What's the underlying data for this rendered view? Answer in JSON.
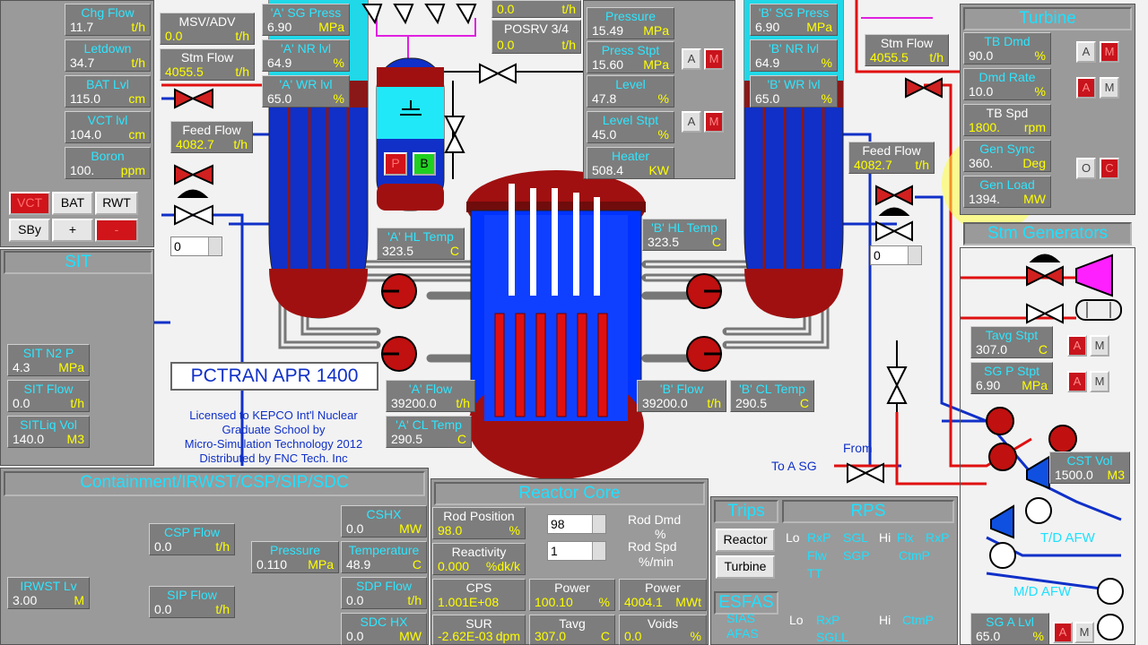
{
  "cvcs": {
    "chg_flow": {
      "label": "Chg Flow",
      "value": "11.7",
      "unit": "t/h"
    },
    "letdown": {
      "label": "Letdown",
      "value": "34.7",
      "unit": "t/h"
    },
    "bat_lvl": {
      "label": "BAT Lvl",
      "value": "115.0",
      "unit": "cm"
    },
    "vct_lvl": {
      "label": "VCT lvl",
      "value": "104.0",
      "unit": "cm"
    },
    "boron": {
      "label": "Boron",
      "value": "100.",
      "unit": "ppm"
    },
    "buttons": {
      "vct": "VCT",
      "bat": "BAT",
      "rwt": "RWT",
      "sby": "SBy",
      "plus": "+",
      "minus": "-"
    }
  },
  "msv": {
    "label": "MSV/ADV",
    "value": "0.0",
    "unit": "t/h"
  },
  "a_stm_flow": {
    "label": "Stm Flow",
    "value": "4055.5",
    "unit": "t/h"
  },
  "a_feed_flow": {
    "label": "Feed Flow",
    "value": "4082.7",
    "unit": "t/h"
  },
  "a_feed_spin": "0",
  "sg_a": {
    "press": {
      "label": "'A' SG Press",
      "value": "6.90",
      "unit": "MPa"
    },
    "nr": {
      "label": "'A' NR lvl",
      "value": "64.9",
      "unit": "%"
    },
    "wr": {
      "label": "'A' WR lvl",
      "value": "65.0",
      "unit": "%"
    }
  },
  "pzr_valves": {
    "top_value": "0.0",
    "top_unit": "t/h",
    "posrv_label": "POSRV 3/4",
    "posrv_value": "0.0",
    "posrv_unit": "t/h"
  },
  "pzr_buttons": {
    "p": "P",
    "b": "B"
  },
  "pressurizer": {
    "pressure": {
      "label": "Pressure",
      "value": "15.49",
      "unit": "MPa"
    },
    "press_stpt": {
      "label": "Press Stpt",
      "value": "15.60",
      "unit": "MPa"
    },
    "level": {
      "label": "Level",
      "value": "47.8",
      "unit": "%"
    },
    "level_stpt": {
      "label": "Level Stpt",
      "value": "45.0",
      "unit": "%"
    },
    "heater": {
      "label": "Heater",
      "value": "508.4",
      "unit": "KW"
    },
    "am1": {
      "a": "A",
      "m": "M"
    },
    "am2": {
      "a": "A",
      "m": "M"
    }
  },
  "sg_b": {
    "press": {
      "label": "'B' SG Press",
      "value": "6.90",
      "unit": "MPa"
    },
    "nr": {
      "label": "'B' NR lvl",
      "value": "64.9",
      "unit": "%"
    },
    "wr": {
      "label": "'B' WR lvl",
      "value": "65.0",
      "unit": "%"
    }
  },
  "b_stm_flow": {
    "label": "Stm Flow",
    "value": "4055.5",
    "unit": "t/h"
  },
  "b_feed_flow": {
    "label": "Feed Flow",
    "value": "4082.7",
    "unit": "t/h"
  },
  "b_feed_spin": "0",
  "turbine": {
    "title": "Turbine",
    "tb_dmd": {
      "label": "TB Dmd",
      "value": "90.0",
      "unit": "%"
    },
    "dmd_rate": {
      "label": "Dmd Rate",
      "value": "10.0",
      "unit": "%"
    },
    "tb_spd": {
      "label": "TB Spd",
      "value": "1800.",
      "unit": "rpm"
    },
    "gen_sync": {
      "label": "Gen Sync",
      "value": "360.",
      "unit": "Deg"
    },
    "gen_load": {
      "label": "Gen Load",
      "value": "1394.",
      "unit": "MW"
    },
    "am1": {
      "a": "A",
      "m": "M"
    },
    "am2": {
      "a": "A",
      "m": "M"
    },
    "oc": {
      "o": "O",
      "c": "C"
    }
  },
  "stm_gen": {
    "title": "Stm Generators",
    "tavg_stpt": {
      "label": "Tavg Stpt",
      "value": "307.0",
      "unit": "C"
    },
    "sgp_stpt": {
      "label": "SG P Stpt",
      "value": "6.90",
      "unit": "MPa"
    },
    "am1": {
      "a": "A",
      "m": "M"
    },
    "am2": {
      "a": "A",
      "m": "M"
    }
  },
  "a_hl_temp": {
    "label": "'A' HL Temp",
    "value": "323.5",
    "unit": "C"
  },
  "b_hl_temp": {
    "label": "'B' HL Temp",
    "value": "323.5",
    "unit": "C"
  },
  "a_flow": {
    "label": "'A' Flow",
    "value": "39200.0",
    "unit": "t/h"
  },
  "a_cl_temp": {
    "label": "'A' CL Temp",
    "value": "290.5",
    "unit": "C"
  },
  "b_flow": {
    "label": "'B' Flow",
    "value": "39200.0",
    "unit": "t/h"
  },
  "b_cl_temp": {
    "label": "'B' CL Temp",
    "value": "290.5",
    "unit": "C"
  },
  "sit": {
    "title": "SIT",
    "n2p": {
      "label": "SIT N2 P",
      "value": "4.3",
      "unit": "MPa"
    },
    "flow": {
      "label": "SIT Flow",
      "value": "0.0",
      "unit": "t/h"
    },
    "liq": {
      "label": "SITLiq Vol",
      "value": "140.0",
      "unit": "M3"
    }
  },
  "banner": {
    "title": "PCTRAN APR 1400",
    "line1": "Licensed to KEPCO Int'l Nuclear",
    "line2": "Graduate School by",
    "line3": "Micro-Simulation Technology 2012",
    "line4": "Distributed by FNC Tech. Inc"
  },
  "to_a_sg": "To A SG",
  "from_label": "From",
  "cst_vol": {
    "label": "CST Vol",
    "value": "1500.0",
    "unit": "M3"
  },
  "td_afw": "T/D AFW",
  "md_afw": "M/D AFW",
  "sg_a_lvl": {
    "label": "SG A Lvl",
    "value": "65.0",
    "unit": "%"
  },
  "containment": {
    "title": "Containment/IRWST/CSP/SIP/SDC",
    "csp_flow": {
      "label": "CSP Flow",
      "value": "0.0",
      "unit": "t/h"
    },
    "sip_flow": {
      "label": "SIP Flow",
      "value": "0.0",
      "unit": "t/h"
    },
    "irwst": {
      "label": "IRWST Lv",
      "value": "3.00",
      "unit": "M"
    },
    "cshx": {
      "label": "CSHX",
      "value": "0.0",
      "unit": "MW"
    },
    "pressure": {
      "label": "Pressure",
      "value": "0.110",
      "unit": "MPa"
    },
    "temperature": {
      "label": "Temperature",
      "value": "48.9",
      "unit": "C"
    },
    "sdp_flow": {
      "label": "SDP Flow",
      "value": "0.0",
      "unit": "t/h"
    },
    "sdc_hx": {
      "label": "SDC HX",
      "value": "0.0",
      "unit": "MW"
    }
  },
  "core": {
    "title": "Reactor Core",
    "rod_position": {
      "label": "Rod Position",
      "value": "98.0",
      "unit": "%"
    },
    "reactivity": {
      "label": "Reactivity",
      "value": "0.000",
      "unit": "%dk/k"
    },
    "cps": {
      "label": "CPS",
      "value": "1.001E+08"
    },
    "sur": {
      "label": "SUR",
      "value": "-2.62E-03",
      "unit": "dpm"
    },
    "rod_dmd_spin": "98",
    "rod_spd_spin": "1",
    "rod_dmd": {
      "label": "Rod Dmd",
      "unit": "%"
    },
    "rod_spd": {
      "label": "Rod Spd",
      "unit": "%/min"
    },
    "power_pct": {
      "label": "Power",
      "value": "100.10",
      "unit": "%"
    },
    "power_mw": {
      "label": "Power",
      "value": "4004.1",
      "unit": "MWt"
    },
    "tavg": {
      "label": "Tavg",
      "value": "307.0",
      "unit": "C"
    },
    "voids": {
      "label": "Voids",
      "value": "0.0",
      "unit": "%"
    }
  },
  "trips": {
    "title": "Trips",
    "reactor": "Reactor",
    "turbine": "Turbine"
  },
  "rps": {
    "title": "RPS",
    "lo": "Lo",
    "rxp": "RxP",
    "sgl": "SGL",
    "hi": "Hi",
    "flx": "Flx",
    "rxp2": "RxP",
    "flw": "Flw",
    "sgp": "SGP",
    "ctmp": "CtmP",
    "tt": "TT"
  },
  "esfas": {
    "title": "ESFAS",
    "sias": "SIAS",
    "afas": "AFAS",
    "lo": "Lo",
    "rxp": "RxP",
    "sgll": "SGLL",
    "hi": "Hi",
    "ctmp": "CtmP"
  },
  "colors": {
    "accent": "#2ee6ff",
    "unit": "#ffff00",
    "panel": "#9a9a9a",
    "vessel_blue": "#0033ff",
    "vessel_red": "#a01010"
  }
}
